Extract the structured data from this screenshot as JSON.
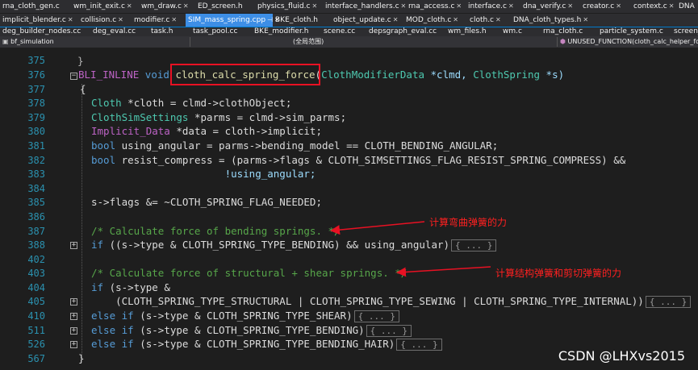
{
  "tabs_row1": [
    {
      "label": "rna_cloth_gen.c",
      "closable": false
    },
    {
      "label": "wm_init_exit.c",
      "closable": true
    },
    {
      "label": "wm_draw.c",
      "closable": true
    },
    {
      "label": "ED_screen.h",
      "closable": false
    },
    {
      "label": "physics_fluid.c",
      "closable": true
    },
    {
      "label": "interface_handlers.c",
      "closable": true
    },
    {
      "label": "rna_access.c",
      "closable": true
    },
    {
      "label": "interface.c",
      "closable": true
    },
    {
      "label": "dna_verify.c",
      "closable": true
    },
    {
      "label": "creator.c",
      "closable": true
    },
    {
      "label": "context.c",
      "closable": true
    },
    {
      "label": "DNA",
      "closable": false
    }
  ],
  "tabs_row2": [
    {
      "label": "implicit_blender.c",
      "closable": true
    },
    {
      "label": "collision.c",
      "closable": true
    },
    {
      "label": "modifier.c",
      "closable": true
    },
    {
      "label": "SIM_mass_spring.cpp",
      "closable": true,
      "active": true
    },
    {
      "label": "BKE_cloth.h",
      "closable": false
    },
    {
      "label": "object_update.c",
      "closable": true
    },
    {
      "label": "MOD_cloth.c",
      "closable": true
    },
    {
      "label": "cloth.c",
      "closable": true
    },
    {
      "label": "DNA_cloth_types.h",
      "closable": true
    }
  ],
  "tabs_row3": [
    "deg_builder_nodes.cc",
    "deg_eval.cc",
    "task.h",
    "task_pool.cc",
    "BKE_modifier.h",
    "scene.cc",
    "depsgraph_eval.cc",
    "wm_files.h",
    "wm.c",
    "rna_cloth.c",
    "particle_system.c",
    "screen_c"
  ],
  "navbar": {
    "project": "bf_simulation",
    "scope": "(全局范围)",
    "function": "UNUSED_FUNCTION(cloth_calc_helper_for"
  },
  "code_lines": [
    {
      "n": "375"
    },
    {
      "n": "376"
    },
    {
      "n": "377"
    },
    {
      "n": "378"
    },
    {
      "n": "379"
    },
    {
      "n": "380"
    },
    {
      "n": "381"
    },
    {
      "n": "382"
    },
    {
      "n": "383"
    },
    {
      "n": "384"
    },
    {
      "n": "385"
    },
    {
      "n": "386"
    },
    {
      "n": "387"
    },
    {
      "n": "388"
    },
    {
      "n": "402"
    },
    {
      "n": "403"
    },
    {
      "n": "404"
    },
    {
      "n": "405"
    },
    {
      "n": "410"
    },
    {
      "n": "511"
    },
    {
      "n": "526"
    },
    {
      "n": "567"
    }
  ],
  "code": {
    "l376_pre": "BLI_INLINE ",
    "l376_void": "void",
    "l376_fn": "cloth_calc_spring_force",
    "l376_args_a": "(",
    "l376_t1": "ClothModifierData",
    "l376_p1": " *clmd, ",
    "l376_t2": "ClothSpring",
    "l376_p2": " *s)",
    "l377": "{",
    "l378_t": "Cloth",
    "l378_rest": " *cloth = clmd->clothObject;",
    "l379_t": "ClothSimSettings",
    "l379_rest": " *parms = clmd->sim_parms;",
    "l380_t": "Implicit_Data",
    "l380_rest": " *data = cloth->implicit;",
    "l381_kw": "bool",
    "l381_rest": " using_angular = parms->bending_model == CLOTH_BENDING_ANGULAR;",
    "l382_kw": "bool",
    "l382_rest": " resist_compress = (parms->flags & CLOTH_SIMSETTINGS_FLAG_RESIST_SPRING_COMPRESS) &&",
    "l383": "                      !using_angular;",
    "l385": "s->flags &= ~CLOTH_SPRING_FLAG_NEEDED;",
    "l387": "/* Calculate force of bending springs. */",
    "l388_kw": "if",
    "l388_rest": " ((s->type & CLOTH_SPRING_TYPE_BENDING) && using_angular)",
    "l403": "/* Calculate force of structural + shear springs. */",
    "l404_kw": "if",
    "l404_rest": " (s->type &",
    "l405": "    (CLOTH_SPRING_TYPE_STRUCTURAL | CLOTH_SPRING_TYPE_SEWING | CLOTH_SPRING_TYPE_INTERNAL))",
    "l410_kw": "else if",
    "l410_rest": " (s->type & CLOTH_SPRING_TYPE_SHEAR)",
    "l511_kw": "else if",
    "l511_rest": " (s->type & CLOTH_SPRING_TYPE_BENDING)",
    "l526_kw": "else if",
    "l526_rest": " (s->type & CLOTH_SPRING_TYPE_BENDING_HAIR)",
    "l567": "}",
    "collapsed": "{ ... }"
  },
  "annotations": {
    "bending": "计算弯曲弹簧的力",
    "structural": "计算结构弹簧和剪切弹簧的力"
  },
  "watermark": "CSDN @LHXvs2015",
  "colors": {
    "highlight_box": "#e81123",
    "arrow": "#e81123",
    "active_tab": "#3d8ee6"
  }
}
